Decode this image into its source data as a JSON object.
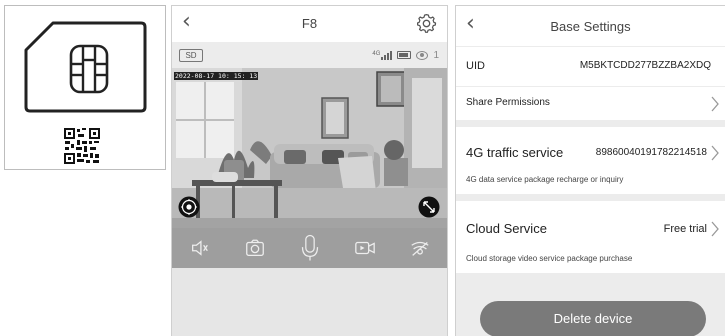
{
  "camera_screen": {
    "title": "F8",
    "sd_badge": "SD",
    "signal_label": "4G",
    "viewer_count": "1",
    "timestamp": "2022-08-17 10: 15: 13",
    "controls": [
      "mute-icon",
      "snapshot-icon",
      "microphone-icon",
      "record-icon",
      "ptz-icon"
    ]
  },
  "settings_screen": {
    "title": "Base Settings",
    "uid_label": "UID",
    "uid_value": "M5BKTCDD277BZZBA2XDQ",
    "share_label": "Share Permissions",
    "traffic_label": "4G traffic service",
    "traffic_value": "89860040191782214518",
    "traffic_sub": "4G data service package recharge or inquiry",
    "cloud_label": "Cloud Service",
    "cloud_value": "Free trial",
    "cloud_sub": "Cloud storage video service package purchase",
    "delete_label": "Delete device"
  },
  "colors": {
    "control_bar": "#9e9e9e",
    "delete_button": "#7a7a7a",
    "section_gap": "#ececec"
  }
}
